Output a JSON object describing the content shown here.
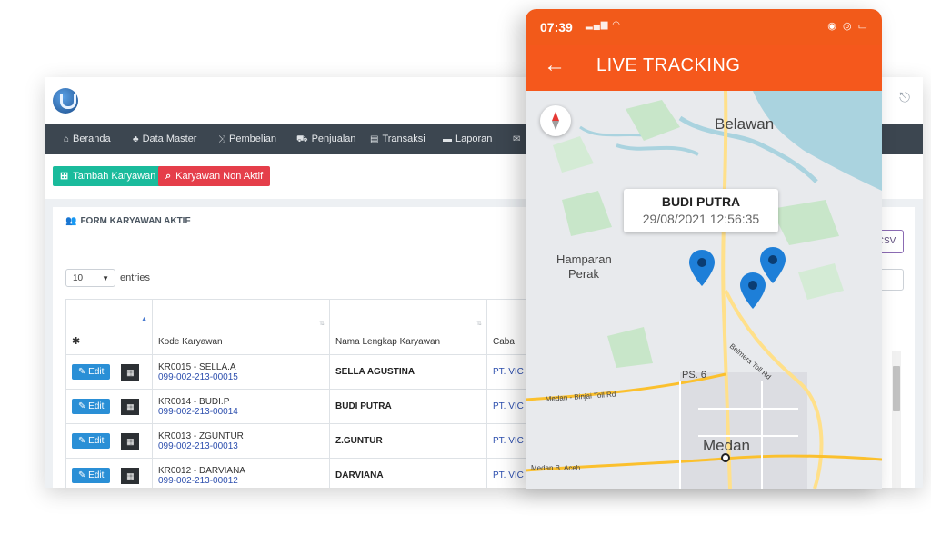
{
  "desktop": {
    "nav": [
      {
        "icon": "home-icon",
        "glyph": "⌂",
        "label": "Beranda"
      },
      {
        "icon": "sitemap-icon",
        "glyph": "♣",
        "label": "Data Master"
      },
      {
        "icon": "shuffle-icon",
        "glyph": "⤨",
        "label": "Pembelian"
      },
      {
        "icon": "cart-icon",
        "glyph": "⛟",
        "label": "Penjualan"
      },
      {
        "icon": "list-icon",
        "glyph": "▤",
        "label": "Transaksi"
      },
      {
        "icon": "folder-icon",
        "glyph": "▬",
        "label": "Laporan"
      }
    ],
    "buttons": {
      "add_employee": "Tambah Karyawan",
      "inactive_employee": "Karyawan Non Aktif"
    },
    "panel_title": "FORM KARYAWAN AKTIF",
    "csv_label": "CSV",
    "entries": {
      "value": "10",
      "label": "entries"
    },
    "table": {
      "columns": [
        "Kode Karyawan",
        "Nama Lengkap Karyawan",
        "Caba"
      ],
      "rows": [
        {
          "code": "KR0015 - SELLA.A",
          "account": "099-002-213-00015",
          "name": "SELLA AGUSTINA",
          "branch": "PT. VIC"
        },
        {
          "code": "KR0014 - BUDI.P",
          "account": "099-002-213-00014",
          "name": "BUDI PUTRA",
          "branch": "PT. VIC"
        },
        {
          "code": "KR0013 - ZGUNTUR",
          "account": "099-002-213-00013",
          "name": "Z.GUNTUR",
          "branch": "PT. VIC"
        },
        {
          "code": "KR0012 - DARVIANA",
          "account": "099-002-213-00012",
          "name": "DARVIANA",
          "branch": "PT. VIC"
        }
      ],
      "edit_label": "Edit"
    }
  },
  "phone": {
    "time": "07:39",
    "title": "LIVE TRACKING",
    "popup": {
      "name": "BUDI PUTRA",
      "datetime": "29/08/2021 12:56:35"
    },
    "map_labels": {
      "belawan": "Belawan",
      "hamparan_1": "Hamparan",
      "hamparan_2": "Perak",
      "ps6": "PS. 6",
      "belmera": "Belmera Toll Rd",
      "binjai": "Medan - Binjai Toll Rd",
      "medan": "Medan",
      "medan_b_aceh": "Medan B. Aceh"
    }
  },
  "colors": {
    "accent_orange": "#f5581c",
    "nav_bg": "#3c4650",
    "btn_green": "#1abb9c",
    "btn_red": "#e53e4a",
    "btn_blue": "#2a8fd6",
    "pin_blue": "#1e7fd8"
  }
}
